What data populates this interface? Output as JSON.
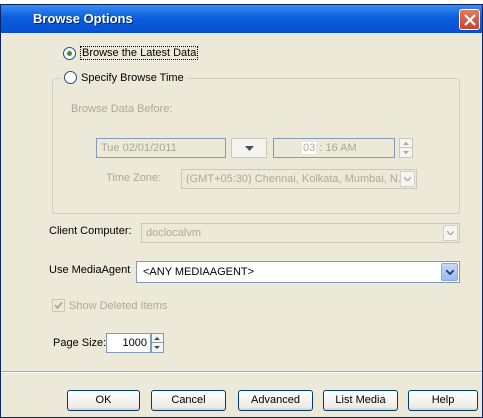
{
  "window": {
    "title": "Browse Options"
  },
  "browse_latest": {
    "label": "Browse the Latest Data",
    "selected": true
  },
  "browse_time": {
    "label": "Specify Browse Time",
    "selected": false,
    "browse_before_label": "Browse Data Before:",
    "date_value": "Tue 02/01/2011",
    "time_hour": "03",
    "time_separator": ":",
    "time_minute": "16",
    "time_ampm": "AM",
    "timezone_label": "Time Zone:",
    "timezone_value": "(GMT+05:30) Chennai, Kolkata, Mumbai, N..."
  },
  "client_computer": {
    "label": "Client Computer:",
    "value": "doclocalvm"
  },
  "media_agent": {
    "label": "Use MediaAgent",
    "value": "<ANY MEDIAAGENT>"
  },
  "show_deleted": {
    "label": "Show Deleted Items",
    "checked": true,
    "enabled": false
  },
  "page_size": {
    "label": "Page Size:",
    "value": "1000"
  },
  "buttons": {
    "ok": "OK",
    "cancel": "Cancel",
    "advanced": "Advanced",
    "list_media": "List Media",
    "help": "Help"
  },
  "colors": {
    "titlebar": "#0a5ede",
    "dialog_bg": "#ece9d8",
    "radio_selected": "#21a121",
    "disabled_text": "#aca899"
  }
}
